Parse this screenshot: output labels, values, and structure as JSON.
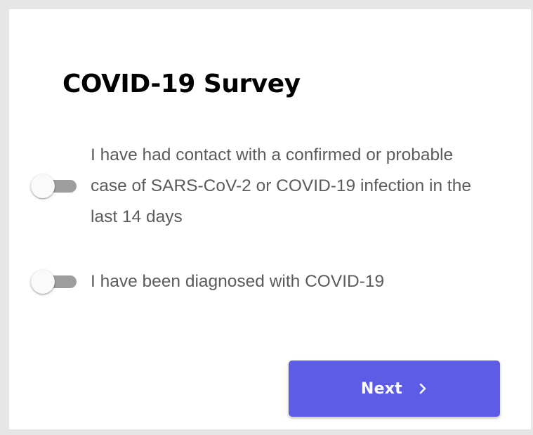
{
  "survey": {
    "title": "COVID-19 Survey",
    "options": [
      {
        "label": "I have had contact with a confirmed or probable case of SARS-CoV-2 or COVID-19 infection in the last 14 days",
        "checked": false
      },
      {
        "label": "I have been diagnosed with COVID-19",
        "checked": false
      }
    ],
    "next_label": "Next",
    "next_icon": "chevron-right-icon"
  },
  "colors": {
    "background": "#e6e6e6",
    "card": "#ffffff",
    "accent": "#5c5ce6",
    "switch_track_off": "#9e9e9e",
    "switch_thumb": "#fafafa",
    "label_text": "#5b5b5b"
  }
}
